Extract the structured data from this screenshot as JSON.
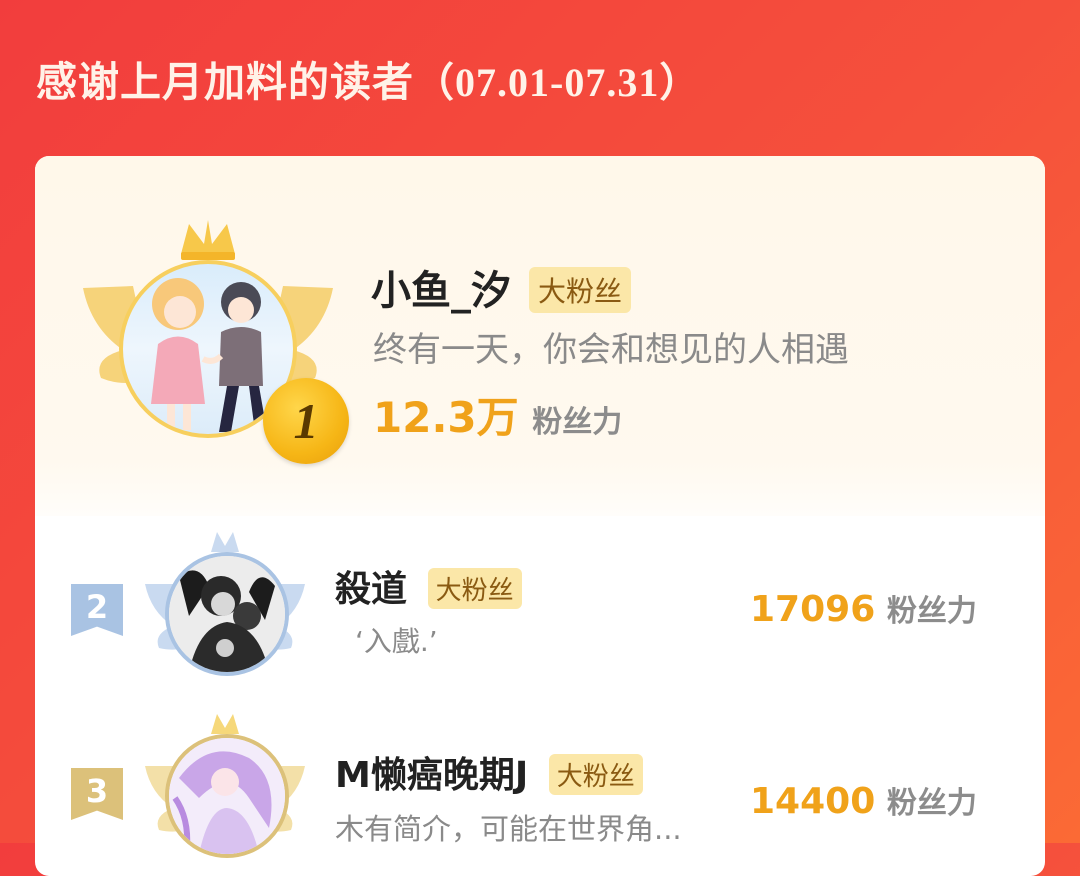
{
  "header": {
    "title": "感谢上月加料的读者",
    "date_range": "（07.01-07.31）"
  },
  "fans": [
    {
      "rank": "1",
      "name": "小鱼_汐",
      "badge": "大粉丝",
      "bio": "终有一天，你会和想见的人相遇",
      "power_value": "12.3万",
      "power_unit": "粉丝力"
    },
    {
      "rank": "2",
      "name": "殺道",
      "badge": "大粉丝",
      "bio": "‘入戲.’",
      "power_value": "17096",
      "power_unit": "粉丝力"
    },
    {
      "rank": "3",
      "name": "M懒癌晚期J",
      "badge": "大粉丝",
      "bio": "木有简介，可能在世界角...",
      "power_value": "14400",
      "power_unit": "粉丝力"
    }
  ],
  "colors": {
    "background": "#f23d3d",
    "accent_gold": "#f0a21a",
    "badge_bg": "#fbe7a8",
    "silver": "#a9c3e3"
  }
}
